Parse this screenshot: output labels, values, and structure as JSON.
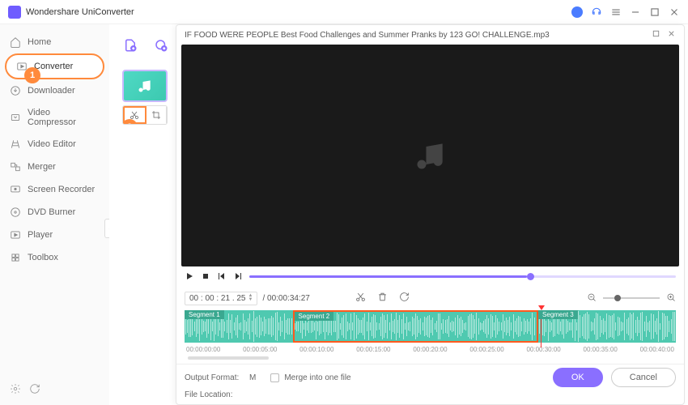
{
  "app": {
    "title": "Wondershare UniConverter"
  },
  "sidebar": {
    "items": [
      {
        "label": "Home"
      },
      {
        "label": "Converter"
      },
      {
        "label": "Downloader"
      },
      {
        "label": "Video Compressor"
      },
      {
        "label": "Video Editor"
      },
      {
        "label": "Merger"
      },
      {
        "label": "Screen Recorder"
      },
      {
        "label": "DVD Burner"
      },
      {
        "label": "Player"
      },
      {
        "label": "Toolbox"
      }
    ]
  },
  "badges": {
    "one": "1",
    "two": "2"
  },
  "editor": {
    "filename": "IF FOOD WERE PEOPLE   Best Food Challenges and Summer Pranks by 123 GO! CHALLENGE.mp3",
    "time_current": "00 : 00 : 21 . 25",
    "time_total": "/ 00:00:34:27",
    "segments": [
      {
        "label": "Segment 1"
      },
      {
        "label": "Segment 2"
      },
      {
        "label": "Segment 3"
      }
    ],
    "ticks": [
      "00:00:00:00",
      "00:00:05:00",
      "00:00:10:00",
      "00:00:15:00",
      "00:00:20:00",
      "00:00:25:00",
      "00:00:30:00",
      "00:00:35:00",
      "00:00:40:00"
    ]
  },
  "bottom": {
    "output_label": "Output Format:",
    "output_value": "M",
    "location_label": "File Location:",
    "merge_label": "Merge into one file",
    "ok": "OK",
    "cancel": "Cancel"
  }
}
